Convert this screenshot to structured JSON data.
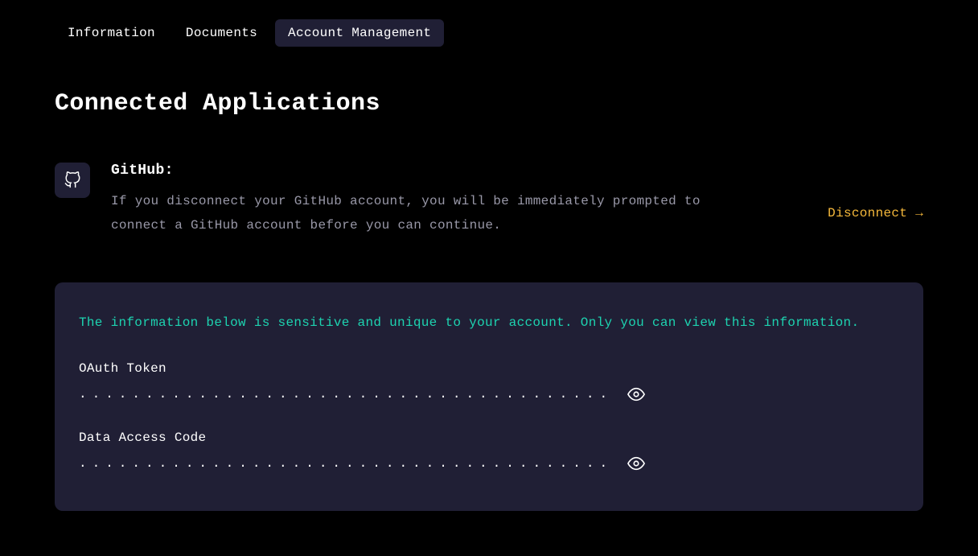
{
  "tabs": [
    {
      "label": "Information",
      "active": false
    },
    {
      "label": "Documents",
      "active": false
    },
    {
      "label": "Account Management",
      "active": true
    }
  ],
  "page_title": "Connected Applications",
  "app": {
    "name": "GitHub:",
    "description": "If you disconnect your GitHub account, you will be immediately prompted to connect a GitHub account before you can continue.",
    "disconnect_label": "Disconnect →"
  },
  "sensitive": {
    "note": "The information below is sensitive and unique to your account. Only you can view this information.",
    "fields": [
      {
        "label": "OAuth Token",
        "masked": "........................................"
      },
      {
        "label": "Data Access Code",
        "masked": "........................................"
      }
    ]
  }
}
